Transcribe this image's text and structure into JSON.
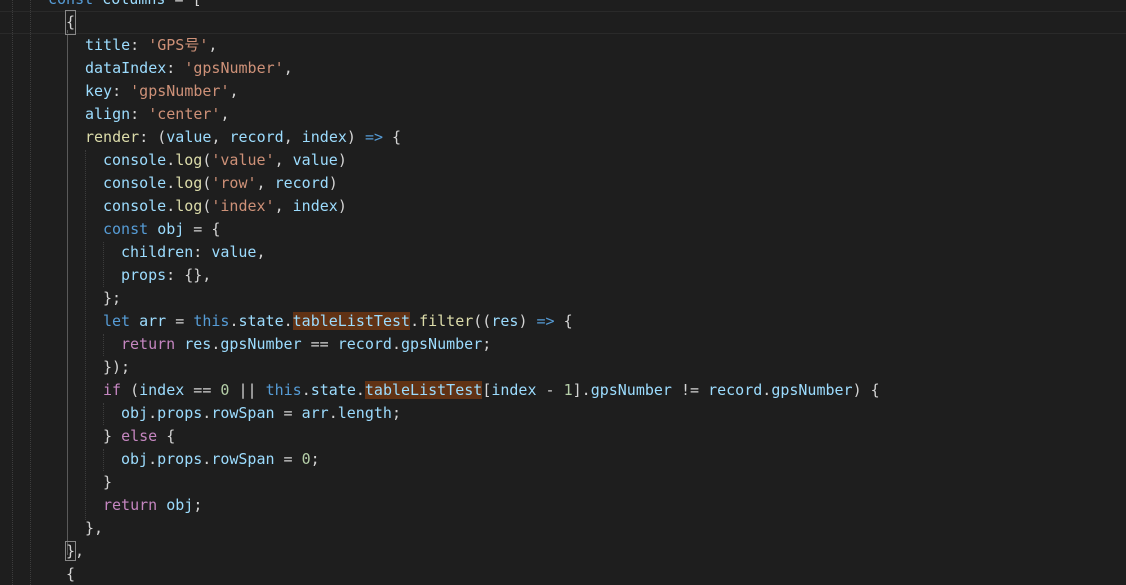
{
  "editor": {
    "theme": "dark",
    "background": "#1e1e1e",
    "lines": [
      "const columns = [",
      "{",
      "title: 'GPS号',",
      "dataIndex: 'gpsNumber',",
      "key: 'gpsNumber',",
      "align: 'center',",
      "render: (value, record, index) => {",
      "console.log('value', value)",
      "console.log('row', record)",
      "console.log('index', index)",
      "const obj = {",
      "children: value,",
      "props: {},",
      "};",
      "let arr = this.state.tableListTest.filter((res) => {",
      "return res.gpsNumber == record.gpsNumber;",
      "});",
      "if (index == 0 || this.state.tableListTest[index - 1].gpsNumber != record.gpsNumber) {",
      "obj.props.rowSpan = arr.length;",
      "} else {",
      "obj.props.rowSpan = 0;",
      "}",
      "return obj;",
      "},",
      "},",
      "{"
    ]
  }
}
